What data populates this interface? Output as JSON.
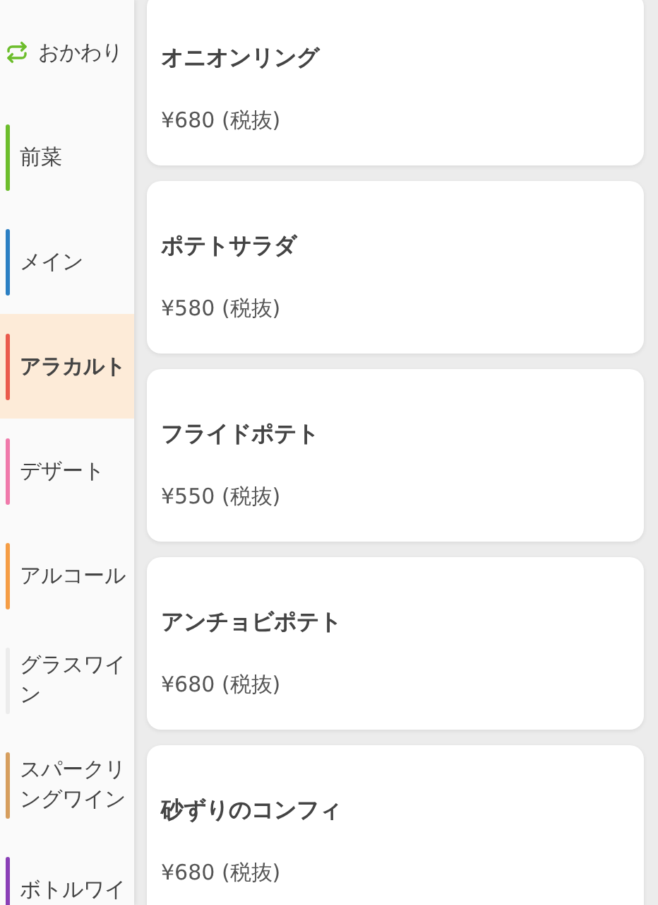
{
  "sidebar": {
    "items": [
      {
        "kind": "refill",
        "label": "おかわり",
        "selected": false,
        "color": "#6cbd2b"
      },
      {
        "kind": "category",
        "label": "前菜",
        "selected": false,
        "color": "#6cbd2b"
      },
      {
        "kind": "category",
        "label": "メイン",
        "selected": false,
        "color": "#2b7fc3"
      },
      {
        "kind": "category",
        "label": "アラカルト",
        "selected": true,
        "color": "#ea5a4c"
      },
      {
        "kind": "category",
        "label": "デザート",
        "selected": false,
        "color": "#f07aab"
      },
      {
        "kind": "category",
        "label": "アルコール",
        "selected": false,
        "color": "#f59d45"
      },
      {
        "kind": "category",
        "label": "グラスワイン",
        "selected": false,
        "color": "#ececec"
      },
      {
        "kind": "category",
        "label": "スパークリングワイン",
        "selected": false,
        "color": "#d69e5e"
      },
      {
        "kind": "category",
        "label": "ボトルワイ",
        "selected": false,
        "color": "#8a3fb6"
      }
    ]
  },
  "menu_items": [
    {
      "name": "オニオンリング",
      "price": "¥680 (税抜)"
    },
    {
      "name": "ポテトサラダ",
      "price": "¥580 (税抜)"
    },
    {
      "name": "フライドポテト",
      "price": "¥550 (税抜)"
    },
    {
      "name": "アンチョビポテト",
      "price": "¥680 (税抜)"
    },
    {
      "name": "砂ずりのコンフィ",
      "price": "¥680 (税抜)"
    }
  ]
}
